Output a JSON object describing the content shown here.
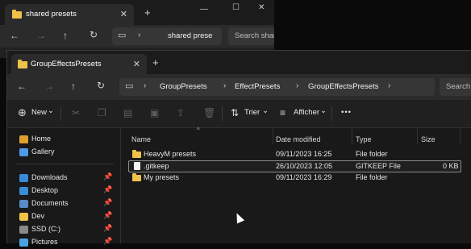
{
  "back_window": {
    "tab_title": "shared presets",
    "close_glyph": "✕",
    "newtab_glyph": "+",
    "minimize_glyph": "—",
    "maximize_glyph": "☐",
    "close_window_glyph": "✕",
    "address_text": "shared prese",
    "address_more": "›",
    "search_placeholder": "Search shar"
  },
  "front_window": {
    "tab_title": "GroupEffectsPresets",
    "close_glyph": "✕",
    "newtab_glyph": "+",
    "breadcrumbs": [
      "GroupPresets",
      "EffectPresets",
      "GroupEffectsPresets"
    ],
    "ellipsis": "…",
    "search_placeholder": "Search G"
  },
  "nav_icons": {
    "back": "←",
    "forward": "→",
    "up": "↑",
    "refresh": "↻",
    "monitor": "▭",
    "chevron": "›"
  },
  "toolbar": {
    "new_label": "New",
    "new_caret": "⌄",
    "sort_label": "Trier",
    "sort_caret": "⌄",
    "view_label": "Afficher",
    "view_caret": "⌄",
    "more_label": "•••",
    "icons": [
      "cut-icon",
      "copy-icon",
      "paste-icon",
      "rename-icon",
      "share-icon",
      "delete-icon"
    ]
  },
  "sidebar": {
    "top_items": [
      {
        "label": "Home",
        "color": "#e0a030"
      },
      {
        "label": "Gallery",
        "color": "#4f9be8"
      }
    ],
    "quick_access": [
      {
        "label": "Downloads",
        "color": "#3b8ad9",
        "pinned": true
      },
      {
        "label": "Desktop",
        "color": "#3a8cd6",
        "pinned": true
      },
      {
        "label": "Documents",
        "color": "#5a8ac8",
        "pinned": true
      },
      {
        "label": "Dev",
        "color": "#f0c24a",
        "pinned": true
      },
      {
        "label": "SSD (C:)",
        "color": "#8a8a8a",
        "pinned": true
      },
      {
        "label": "Pictures",
        "color": "#4aa3e0",
        "pinned": true
      }
    ],
    "pin_glyph": "📌"
  },
  "file_list": {
    "columns": [
      "Name",
      "Date modified",
      "Type",
      "Size"
    ],
    "sort_caret": "^",
    "rows": [
      {
        "name": "HeavyM presets",
        "date": "09/11/2023 16:25",
        "type": "File folder",
        "size": "",
        "kind": "folder"
      },
      {
        "name": ".gitkeep",
        "date": "26/10/2023 12:05",
        "type": "GITKEEP File",
        "size": "0 KB",
        "kind": "file"
      },
      {
        "name": "My presets",
        "date": "09/11/2023 16:29",
        "type": "File folder",
        "size": "",
        "kind": "folder"
      }
    ]
  },
  "colors": {
    "folder": "#f0c24a",
    "background": "#191919",
    "accent": "#4f9be8"
  }
}
